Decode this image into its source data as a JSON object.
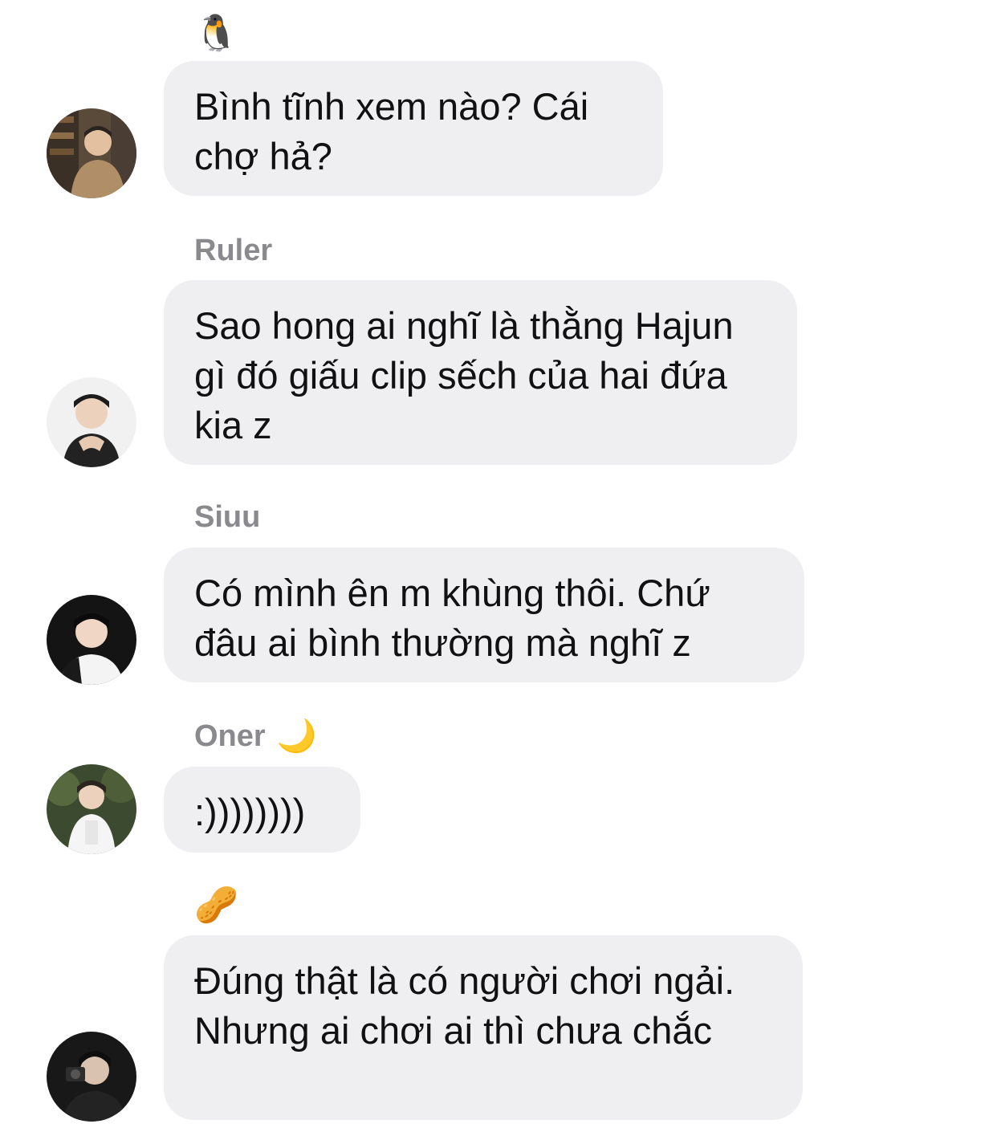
{
  "messages": [
    {
      "sender_name": "",
      "sender_emoji": "🐧",
      "icon": "penguin-icon",
      "text": "Bình tĩnh xem nào? Cái chợ hả?"
    },
    {
      "sender_name": "Ruler",
      "sender_emoji": "",
      "text": "Sao hong ai nghĩ là thằng Hajun gì đó giấu clip sếch của hai đứa kia z"
    },
    {
      "sender_name": "Siuu",
      "sender_emoji": "",
      "text": "Có mình ên m khùng thôi. Chứ đâu ai bình thường mà nghĩ z"
    },
    {
      "sender_name": "Oner",
      "sender_emoji": "🌙",
      "icon": "crescent-moon-icon",
      "text": ":))))))))"
    },
    {
      "sender_name": "",
      "sender_emoji": "🥜",
      "icon": "peanut-icon",
      "text": "Đúng thật là có người chơi ngải. Nhưng ai chơi ai thì chưa chắc"
    }
  ],
  "colors": {
    "bubble_bg": "#efeff2",
    "sender_name": "#8a8a8e",
    "text": "#111111"
  }
}
